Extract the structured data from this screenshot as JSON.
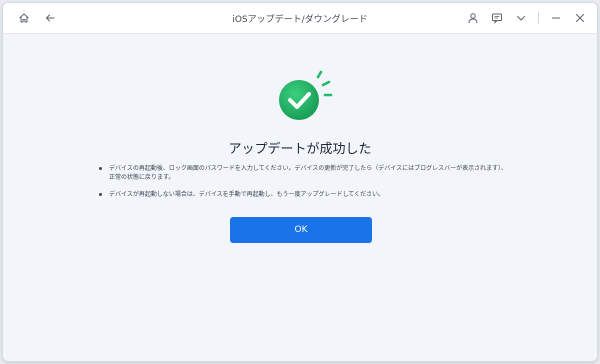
{
  "window": {
    "title": "iOSアップデート/ダウングレード"
  },
  "titlebar": {
    "left_icons": [
      "home-icon",
      "back-arrow-icon"
    ],
    "right_icons": [
      "user-icon",
      "feedback-icon",
      "dropdown-icon",
      "minimize-icon",
      "close-icon"
    ]
  },
  "result": {
    "status_icon": "check-icon",
    "title": "アップデートが成功した",
    "notes": [
      "デバイスの再起動後、ロック画面のパスワードを入力してください。デバイスの更新が完了したら（デバイスにはプログレスバーが表示されます）、正常の状態に戻ります。",
      "デバイスが再起動しない場合は、デバイスを手動で再起動し、もう一度アップグレードしてください。"
    ],
    "ok_label": "OK"
  },
  "colors": {
    "accent": "#1a73e8",
    "success": "#1fae63",
    "background": "#f2f5fa"
  }
}
